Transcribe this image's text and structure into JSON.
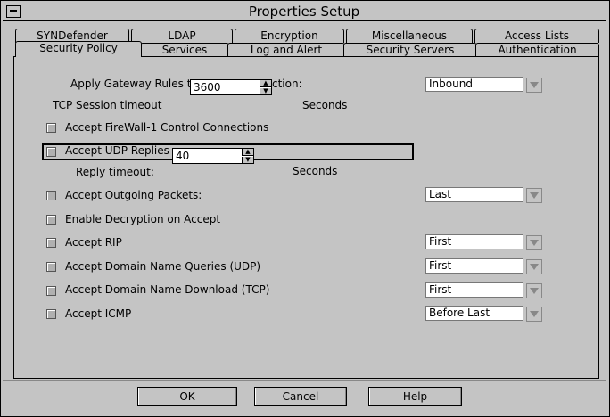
{
  "window": {
    "title": "Properties Setup"
  },
  "tabs_row1": [
    "SYNDefender",
    "LDAP",
    "Encryption",
    "Miscellaneous",
    "Access Lists"
  ],
  "tabs_row2": [
    "Security Policy",
    "Services",
    "Log and Alert",
    "Security Servers",
    "Authentication"
  ],
  "active_tab": "Security Policy",
  "gateway": {
    "label_left": "Apply Gateway Rules t",
    "label_right": "ction:",
    "spin_value": "3600",
    "direction": "Inbound"
  },
  "tcp": {
    "label": "TCP Session timeout",
    "unit": "Seconds"
  },
  "fw1": {
    "label": "Accept FireWall-1 Control Connections"
  },
  "udp": {
    "label": "Accept UDP Replies",
    "spin_value": "40",
    "timeout_label": "Reply timeout:",
    "unit": "Seconds"
  },
  "outgoing": {
    "label": "Accept Outgoing Packets:",
    "value": "Last"
  },
  "decrypt": {
    "label": "Enable Decryption on Accept"
  },
  "rip": {
    "label": "Accept RIP",
    "value": "First"
  },
  "dns_udp": {
    "label": "Accept Domain Name Queries (UDP)",
    "value": "First"
  },
  "dns_tcp": {
    "label": "Accept Domain Name Download (TCP)",
    "value": "First"
  },
  "icmp": {
    "label": "Accept ICMP",
    "value": "Before Last"
  },
  "buttons": {
    "ok": "OK",
    "cancel": "Cancel",
    "help": "Help"
  }
}
